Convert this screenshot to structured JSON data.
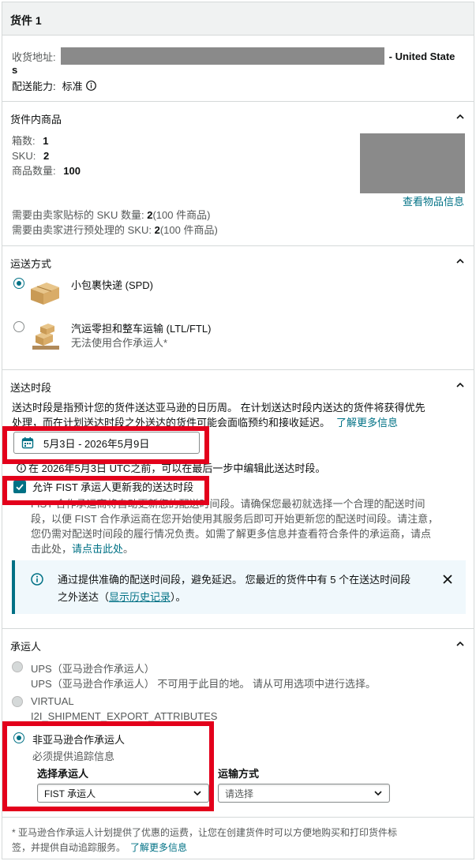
{
  "shipment": {
    "title": "货件 1",
    "address_label": "收货地址:",
    "address_country_a": "- United State",
    "address_country_b": "s",
    "capability_label": "配送能力:",
    "capability_value": "标准"
  },
  "items": {
    "title": "货件内商品",
    "boxes_label": "箱数:",
    "boxes_value": "1",
    "sku_label": "SKU:",
    "sku_value": "2",
    "qty_label": "商品数量:",
    "qty_value": "100",
    "view_link": "查看物品信息",
    "label_line_text": "需要由卖家贴标的 SKU 数量:",
    "label_line_count": "2",
    "label_line_suffix": "(100 件商品)",
    "prep_line_text": "需要由卖家进行预处理的 SKU:",
    "prep_line_count": "2",
    "prep_line_suffix": "(100 件商品)"
  },
  "shipping_mode": {
    "title": "运送方式",
    "options": [
      {
        "label": "小包裹快递 (SPD)",
        "sub": "",
        "selected": true
      },
      {
        "label": "汽运零担和整车运输 (LTL/FTL)",
        "sub": "无法使用合作承运人*",
        "selected": false
      }
    ]
  },
  "delivery_window": {
    "title": "送达时段",
    "desc_1": "送达时段是指预计您的货件送达亚马逊的日历周。 在计划送达时段内送达的货件将获得优先",
    "desc_2": "处理，而在计划送达时段之外送达的货件可能会面临预约和接收延迟。",
    "learn_more": "了解更多信息",
    "date_value": "5月3日 - 2026年5月9日",
    "edit_note": "在 2026年5月3日 UTC之前，可以在最后一步中编辑此送达时段。",
    "checkbox_label": "允许 FIST 承运人更新我的送达时段",
    "fist_p1": "FIST 合作承运商将自动更新您的配送时间段。请确保您最初就选择一个合理的配送时间",
    "fist_p2": "段，以便 FIST 合作承运商在您开始使用其服务后即可开始更新您的配送时间段。请注意，",
    "fist_p3": "您仍需对配送时间段的履行情况负责。如需了解更多信息并查看符合条件的承运商，请点",
    "fist_p4_a": "击此处，",
    "fist_p4_link": "请点击此处",
    "fist_p4_b": "。",
    "alert_1": "通过提供准确的配送时间段，避免延迟。 您最近的货件中有 5 个在送达时间段",
    "alert_2_a": "之外送达（",
    "alert_2_link": "显示历史记录",
    "alert_2_b": "）。"
  },
  "carrier": {
    "title": "承运人",
    "ups_label": "UPS（亚马逊合作承运人）",
    "ups_note": "UPS（亚马逊合作承运人） 不可用于此目的地。 请从可用选项中进行选择。",
    "virtual_label": "VIRTUAL",
    "virtual_note": "I2I_SHIPMENT_EXPORT_ATTRIBUTES",
    "non_partner_label": "非亚马逊合作承运人",
    "tracking_note": "必须提供追踪信息",
    "select_carrier_label": "选择承运人",
    "select_carrier_value": "FIST 承运人",
    "transport_label": "运输方式",
    "transport_placeholder": "请选择"
  },
  "footer": {
    "note": "* 亚马逊合作承运人计划提供了优惠的运费，让您在创建货件时可以方便地购买和打印货件标",
    "note_2": "签，并提供自动追踪服务。",
    "learn_more": "了解更多信息"
  },
  "colors": {
    "accent": "#007185",
    "highlight": "#e3001b",
    "header_bg": "#f0f2f2",
    "alert_bg": "#f0f8fc"
  }
}
